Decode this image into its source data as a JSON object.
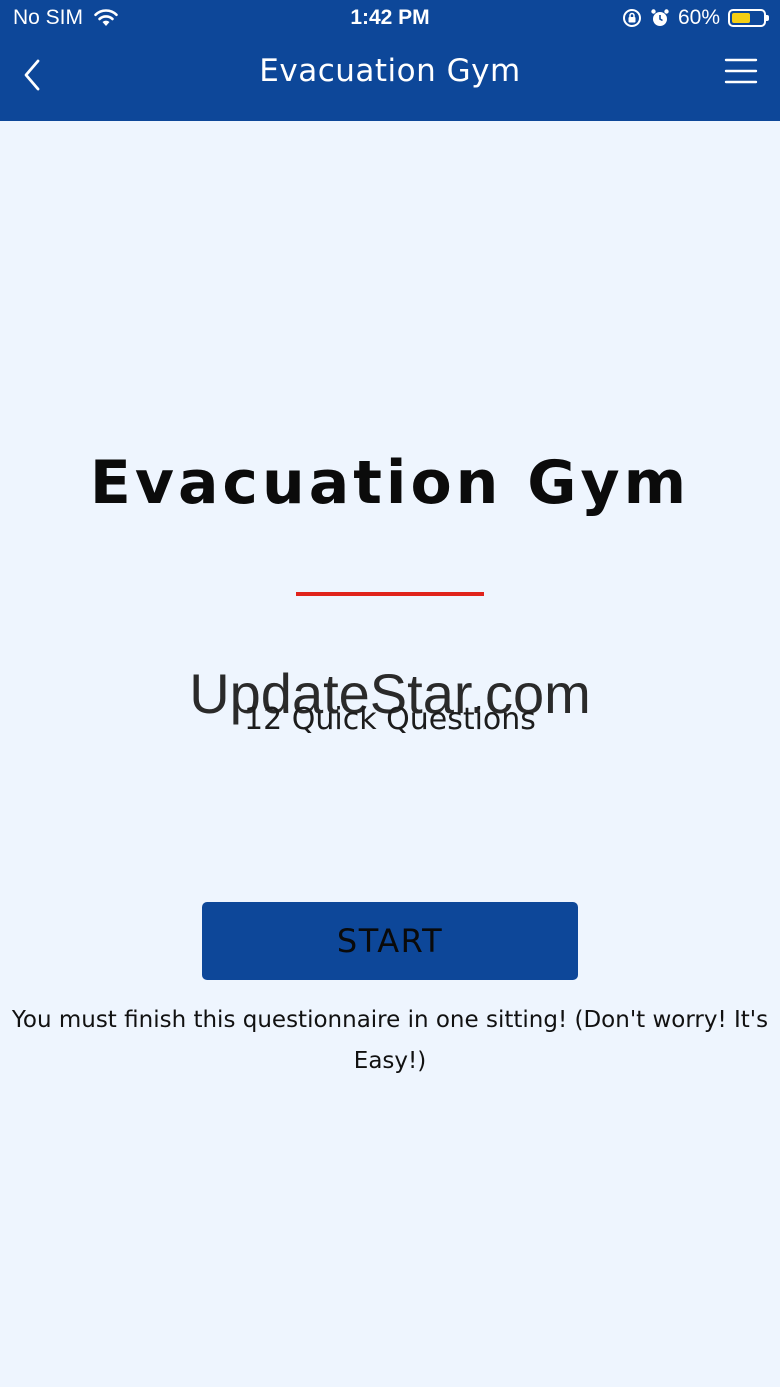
{
  "status_bar": {
    "carrier": "No SIM",
    "time": "1:42 PM",
    "battery_percent": "60%",
    "battery_level": 0.6,
    "wifi_icon": "wifi-icon",
    "rotation_lock_icon": "rotation-lock-icon",
    "alarm_icon": "alarm-icon",
    "battery_color": "#f5cf13"
  },
  "nav": {
    "title": "Evacuation Gym",
    "back_icon": "chevron-left-icon",
    "menu_icon": "hamburger-menu-icon",
    "background_color": "#0d4799"
  },
  "main": {
    "title": "Evacuation Gym",
    "divider_color": "#e0231c",
    "watermark": "UpdateStar.com",
    "subtitle": "12 Quick Questions",
    "start_label": "START",
    "notice": "You must finish this questionnaire in one sitting! (Don't worry! It's Easy!)"
  }
}
